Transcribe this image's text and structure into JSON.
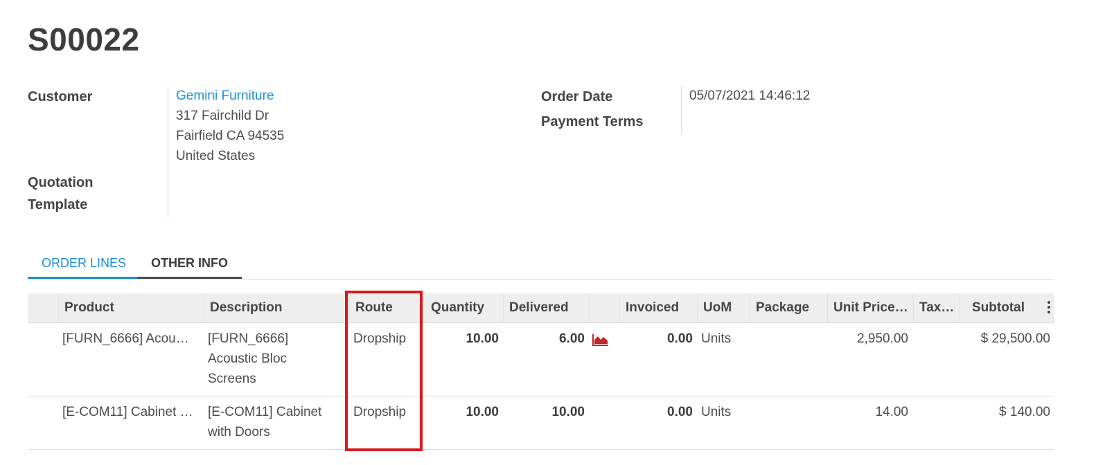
{
  "order": {
    "name": "S00022"
  },
  "fields": {
    "customer_label": "Customer",
    "customer_name": "Gemini Furniture",
    "address_line1": "317 Fairchild Dr",
    "address_line2": "Fairfield CA 94535",
    "address_line3": "United States",
    "quotation_template_label_1": "Quotation",
    "quotation_template_label_2": "Template",
    "order_date_label": "Order Date",
    "order_date_value": "05/07/2021 14:46:12",
    "payment_terms_label": "Payment Terms"
  },
  "tabs": [
    {
      "label": "ORDER LINES",
      "active": true
    },
    {
      "label": "OTHER INFO",
      "active": false
    }
  ],
  "table": {
    "headers": {
      "product": "Product",
      "description": "Description",
      "route": "Route",
      "quantity": "Quantity",
      "delivered": "Delivered",
      "invoiced": "Invoiced",
      "uom": "UoM",
      "package": "Package",
      "unit_price": "Unit Price…",
      "taxes": "Tax…",
      "subtotal": "Subtotal"
    },
    "rows": [
      {
        "product": "[FURN_6666] Acou…",
        "description_l1": "[FURN_6666]",
        "description_l2": "Acoustic Bloc",
        "description_l3": "Screens",
        "route": "Dropship",
        "quantity": "10.00",
        "delivered": "6.00",
        "forecast_icon": "area-chart-icon",
        "invoiced": "0.00",
        "uom": "Units",
        "unit_price": "2,950.00",
        "subtotal": "$ 29,500.00"
      },
      {
        "product": "[E-COM11] Cabinet …",
        "description_l1": "[E-COM11] Cabinet",
        "description_l2": "with Doors",
        "route": "Dropship",
        "quantity": "10.00",
        "delivered": "10.00",
        "invoiced": "0.00",
        "uom": "Units",
        "unit_price": "14.00",
        "subtotal": "$ 140.00"
      }
    ]
  },
  "colors": {
    "accent": "#1a8fd8",
    "highlight": "#d9191c",
    "forecast_icon": "#c0272d"
  }
}
